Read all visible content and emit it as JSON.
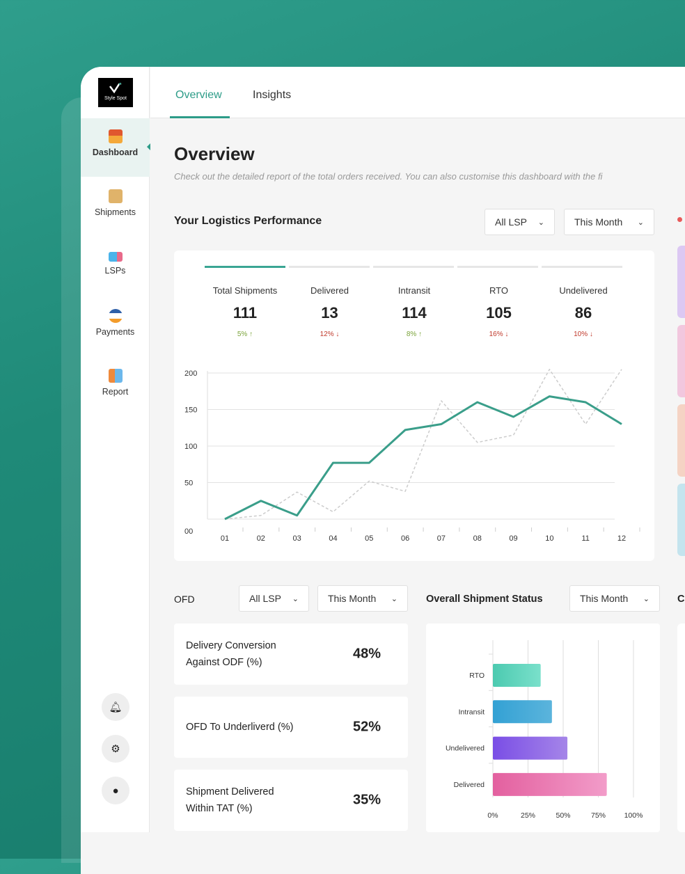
{
  "brand": {
    "name": "Style Spot"
  },
  "sidebar": {
    "items": [
      {
        "label": "Dashboard",
        "icon": "house-icon",
        "active": true
      },
      {
        "label": "Shipments",
        "icon": "package-icon"
      },
      {
        "label": "LSPs",
        "icon": "truck-icon"
      },
      {
        "label": "Payments",
        "icon": "visa-card-icon"
      },
      {
        "label": "Report",
        "icon": "report-icon"
      }
    ],
    "bottom": [
      {
        "icon": "bell-icon"
      },
      {
        "icon": "gear-icon"
      },
      {
        "icon": "user-icon"
      }
    ]
  },
  "tabs": [
    {
      "label": "Overview",
      "active": true
    },
    {
      "label": "Insights"
    }
  ],
  "page": {
    "title": "Overview",
    "subtitle": "Check out the detailed report of the total orders received. You can also customise this dashboard with the fi"
  },
  "logistics": {
    "title": "Your Logistics Performance",
    "lsp_filter": "All LSP",
    "period_filter": "This Month",
    "stats": [
      {
        "label": "Total Shipments",
        "value": "111",
        "change": "5%",
        "dir": "up"
      },
      {
        "label": "Delivered",
        "value": "13",
        "change": "12%",
        "dir": "down"
      },
      {
        "label": "Intransit",
        "value": "114",
        "change": "8%",
        "dir": "up"
      },
      {
        "label": "RTO",
        "value": "105",
        "change": "16%",
        "dir": "down"
      },
      {
        "label": "Undelivered",
        "value": "86",
        "change": "10%",
        "dir": "down"
      }
    ]
  },
  "chart_data": [
    {
      "type": "line",
      "categories": [
        "01",
        "02",
        "03",
        "04",
        "05",
        "06",
        "07",
        "08",
        "09",
        "10",
        "11",
        "12"
      ],
      "yticks": [
        "00",
        "50",
        "100",
        "150",
        "200"
      ],
      "ylim": [
        0,
        200
      ],
      "grid": true,
      "series": [
        {
          "style": "solid",
          "color": "#3a9e8a",
          "values": [
            0,
            25,
            5,
            77,
            77,
            122,
            130,
            160,
            140,
            168,
            160,
            130
          ]
        },
        {
          "style": "dashed",
          "color": "#cccccc",
          "values": [
            0,
            5,
            37,
            10,
            52,
            38,
            162,
            105,
            115,
            205,
            130,
            205
          ]
        }
      ]
    },
    {
      "type": "bar",
      "orientation": "horizontal",
      "title": "Overall Shipment Status",
      "categories": [
        "RTO",
        "Intransit",
        "Undelivered",
        "Delivered"
      ],
      "values": [
        34,
        42,
        53,
        81
      ],
      "xticks": [
        "0%",
        "25%",
        "50%",
        "75%",
        "100%"
      ],
      "xlim": [
        0,
        100
      ],
      "colors": [
        [
          "#4ccab0",
          "#7ae0cb"
        ],
        [
          "#33a1d4",
          "#5bb4dc"
        ],
        [
          "#7a4ee6",
          "#a585e8"
        ],
        [
          "#e3609f",
          "#f29cc9"
        ]
      ]
    }
  ],
  "ofd": {
    "title": "OFD",
    "lsp_filter": "All LSP",
    "period_filter": "This Month",
    "cards": [
      {
        "label": "Delivery Conversion Against ODF (%)",
        "value": "48%"
      },
      {
        "label": "OFD To Underliverd (%)",
        "value": "52%"
      },
      {
        "label": "Shipment Delivered Within TAT (%)",
        "value": "35%"
      }
    ]
  },
  "status": {
    "title": "Overall Shipment Status",
    "period_filter": "This Month"
  },
  "right_cut": {
    "heading_fragment": "C",
    "pill_colors": [
      "#dcc8f3",
      "#f2c7de",
      "#f5d3c4",
      "#c4e4ee"
    ]
  }
}
